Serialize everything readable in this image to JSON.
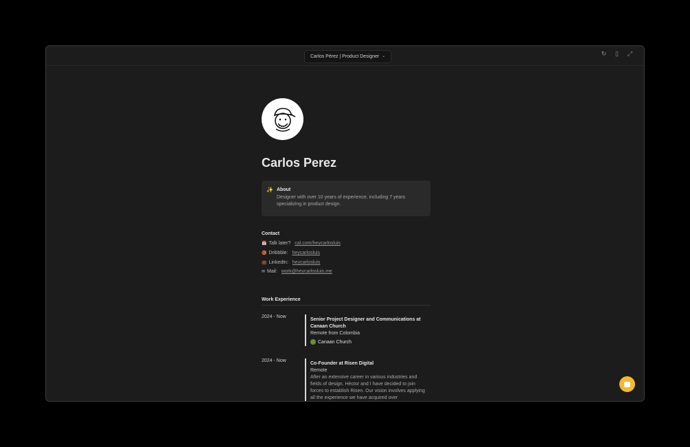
{
  "window": {
    "title": "Carlos Pérez | Product Designer"
  },
  "toolbar": {
    "icons": [
      "refresh-icon",
      "mobile-icon",
      "collapse-icon"
    ]
  },
  "profile": {
    "name": "Carlos Perez"
  },
  "about": {
    "heading": "About",
    "text": "Designer with over 10 years of experience, including 7 years specializing in product design."
  },
  "contact": {
    "heading": "Contact",
    "items": [
      {
        "icon": "calendar-icon",
        "label": "Talk later?",
        "link": "cal.com/heycarlosluis"
      },
      {
        "icon": "dribbble-icon",
        "label": "Dribbble:",
        "link": "heycarlosluis"
      },
      {
        "icon": "briefcase-icon",
        "label": "LinkedIn:",
        "link": "heycarlosluis"
      },
      {
        "icon": "mail-icon",
        "label": "Mail:",
        "link": "work@heycarlosluis.me"
      }
    ]
  },
  "work": {
    "heading": "Work Experience",
    "jobs": [
      {
        "date": "2024 - Now",
        "role": "Senior Project Designer and Communications at Canaan Church",
        "location": "Remote from Colombia",
        "org": "Canaan Church"
      },
      {
        "date": "2024 - Now",
        "role": "Co-Founder at Risen Digital",
        "location": "Remote",
        "description": "After an extensive career in various industries and fields of design, Héctor and I have decided to join forces to establish Risen. Our vision involves applying all the experience we have acquired over"
      }
    ]
  }
}
